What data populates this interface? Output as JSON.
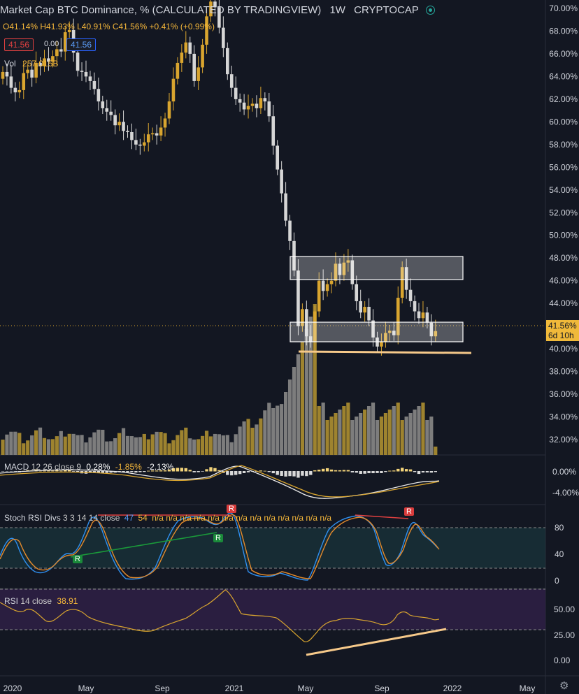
{
  "header": {
    "title": "Market Cap BTC Dominance, % (CALCULATED BY TRADINGVIEW)",
    "interval": "1W",
    "source": "CRYPTOCAP",
    "ohlc": {
      "open": "O41.14%",
      "high": "H41.93%",
      "low": "L40.91%",
      "close": "C41.56%",
      "change": "+0.41% (+0.99%)"
    },
    "bid": "41.56",
    "spread": "0.00",
    "ask": "41.56",
    "volume_label": "Vol",
    "volume_value": "257.015B"
  },
  "price_axis": {
    "ticks": [
      "70.00%",
      "68.00%",
      "66.00%",
      "64.00%",
      "62.00%",
      "60.00%",
      "58.00%",
      "56.00%",
      "54.00%",
      "52.00%",
      "50.00%",
      "48.00%",
      "46.00%",
      "44.00%",
      "42.00%",
      "40.00%",
      "38.00%",
      "36.00%",
      "34.00%",
      "32.00%"
    ],
    "last_price": "41.56%",
    "countdown": "6d 10h"
  },
  "time_axis": {
    "labels": [
      "2020",
      "May",
      "Sep",
      "2021",
      "May",
      "Sep",
      "2022",
      "May"
    ]
  },
  "colors": {
    "up": "#d9a52f",
    "down": "#d6d6d6",
    "vol_up": "#9e832f",
    "vol_down": "#7d7d7d",
    "bg": "#131722",
    "line": "#f6c98a",
    "box": "#ffffff"
  },
  "macd": {
    "label": "MACD",
    "params": "12 26 close 9",
    "v1": "0.28%",
    "v2": "-1.85%",
    "v3": "-2.13%",
    "axis": [
      "0.00%",
      "-4.00%"
    ]
  },
  "stoch": {
    "label": "Stoch RSI Divs",
    "params": "3 3 14 14 close",
    "k": "47",
    "d": "54",
    "na": "n/a n/a n/a n/a n/a n/a n/a n/a n/a n/a n/a n/a n/a",
    "axis": [
      "80",
      "40",
      "0"
    ],
    "markers": [
      "R",
      "R",
      "R",
      "R"
    ]
  },
  "rsi": {
    "label": "RSI",
    "params": "14 close",
    "value": "38.91",
    "axis": [
      "50.00",
      "25.00",
      "0.00"
    ]
  },
  "chart_data": {
    "type": "candlestick",
    "title": "Market Cap BTC Dominance, % (CALCULATED BY TRADINGVIEW)",
    "x": "weekly, Jan 2020 – Nov 2021",
    "ylim": [
      30.5,
      70.8
    ],
    "close": [
      64.4,
      64.0,
      63.0,
      62.6,
      62.8,
      64.3,
      64.6,
      63.9,
      65.2,
      64.9,
      65.6,
      65.3,
      65.8,
      66.4,
      66.2,
      67.9,
      68.1,
      66.1,
      64.5,
      64.4,
      64.0,
      63.6,
      62.9,
      61.8,
      61.2,
      60.9,
      60.6,
      59.7,
      60.0,
      59.2,
      59.1,
      58.4,
      58.0,
      57.9,
      58.2,
      58.9,
      59.0,
      58.8,
      59.5,
      60.3,
      61.8,
      63.8,
      65.2,
      66.1,
      67.0,
      66.0,
      63.6,
      64.8,
      66.8,
      69.3,
      70.6,
      70.1,
      68.3,
      66.5,
      64.2,
      63.0,
      62.0,
      61.7,
      61.1,
      61.4,
      61.6,
      61.2,
      62.1,
      61.8,
      60.5,
      57.9,
      55.8,
      53.7,
      51.3,
      49.5,
      46.9,
      42.0,
      43.5,
      41.1,
      40.6,
      43.3,
      46.0,
      45.1,
      45.7,
      46.0,
      47.5,
      46.5,
      47.6,
      47.8,
      45.7,
      44.2,
      43.2,
      43.7,
      42.5,
      41.0,
      40.2,
      40.6,
      41.4,
      41.6,
      41.2,
      44.5,
      47.2,
      45.2,
      44.2,
      43.3,
      42.7,
      43.2,
      42.3,
      41.1,
      41.56
    ],
    "volume_series_approx": "weekly volume bars, peak ~2021 May"
  }
}
